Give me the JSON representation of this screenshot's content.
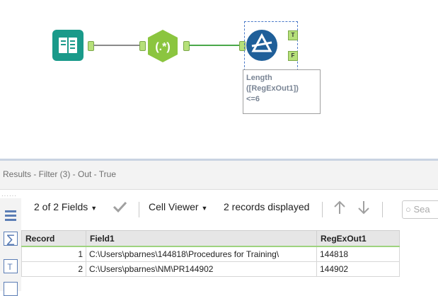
{
  "workflow": {
    "tools": [
      {
        "name": "Input Data",
        "icon": "book-icon"
      },
      {
        "name": "RegEx",
        "icon": "regex-icon",
        "glyph": "(.*)"
      },
      {
        "name": "Filter",
        "icon": "filter-icon",
        "true_anchor": "T",
        "false_anchor": "F"
      }
    ],
    "annotation": {
      "line1": "Length",
      "line2": "([RegExOut1])",
      "line3": "<=6"
    }
  },
  "results": {
    "title": "Results - Filter (3) - Out - True",
    "toolbar": {
      "fields": "2 of 2 Fields",
      "viewer": "Cell Viewer",
      "records": "2 records displayed",
      "search_placeholder": "Sea"
    },
    "columns": [
      "Record",
      "Field1",
      "RegExOut1"
    ],
    "rows": [
      {
        "record": "1",
        "field1": "C:\\Users\\pbarnes\\144818\\Procedures for Training\\",
        "regex": "144818"
      },
      {
        "record": "2",
        "field1": "C:\\Users\\pbarnes\\NM\\PR144902",
        "regex": "144902"
      }
    ]
  },
  "colors": {
    "accent_green": "#4aa84a",
    "tool_teal": "#1a9a8a",
    "regex_green": "#8bc53f",
    "filter_blue": "#1f5f99"
  }
}
